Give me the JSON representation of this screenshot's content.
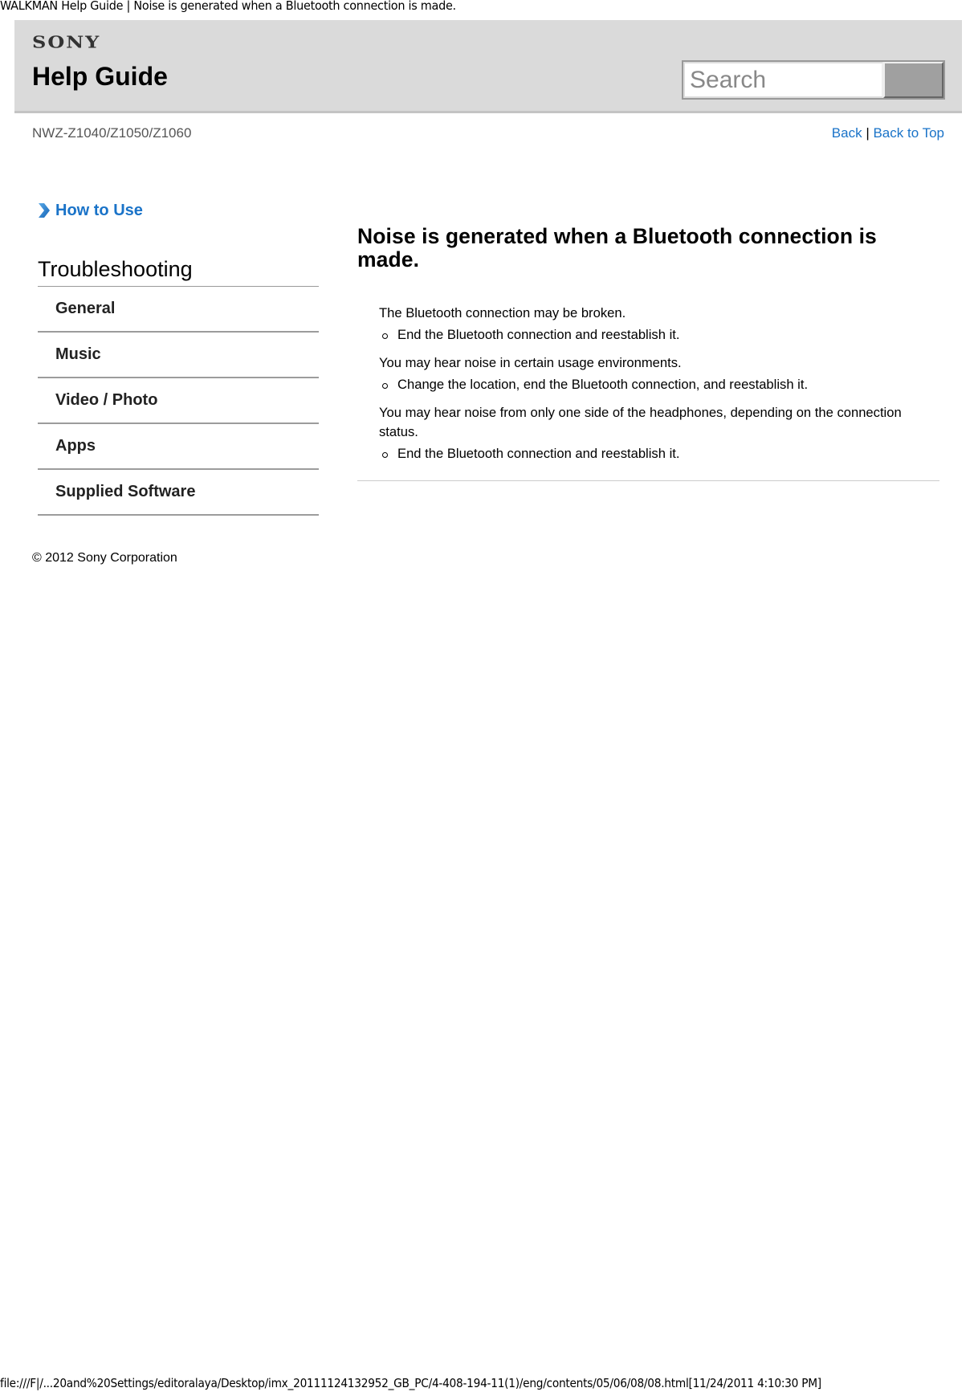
{
  "document_title": "WALKMAN Help Guide | Noise is generated when a Bluetooth connection is made.",
  "header": {
    "logo": "SONY",
    "title": "Help Guide",
    "search": {
      "placeholder": "Search",
      "value": ""
    },
    "search_button_label": ""
  },
  "model": "NWZ-Z1040/Z1050/Z1060",
  "nav": {
    "back": "Back",
    "separator": "|",
    "back_to_top": "Back to Top"
  },
  "sidebar": {
    "how_to_use": {
      "icon": "chevron-right-icon",
      "label": "How to Use"
    },
    "section_title": "Troubleshooting",
    "items": [
      {
        "label": "General"
      },
      {
        "label": "Music"
      },
      {
        "label": "Video / Photo"
      },
      {
        "label": "Apps"
      },
      {
        "label": "Supplied Software"
      }
    ]
  },
  "article": {
    "heading": "Noise is generated when a Bluetooth connection is made.",
    "sections": [
      {
        "cause": "The Bluetooth connection may be broken.",
        "remedy": "End the Bluetooth connection and reestablish it."
      },
      {
        "cause": "You may hear noise in certain usage environments.",
        "remedy": "Change the location, end the Bluetooth connection, and reestablish it."
      },
      {
        "cause": "You may hear noise from only one side of the headphones, depending on the connection status.",
        "remedy": "End the Bluetooth connection and reestablish it."
      }
    ]
  },
  "copyright": "© 2012 Sony Corporation",
  "footer_path": "file:///F|/...20and%20Settings/editoralaya/Desktop/imx_20111124132952_GB_PC/4-408-194-11(1)/eng/contents/05/06/08/08.html[11/24/2011 4:10:30 PM]",
  "colors": {
    "link": "#1a73c8",
    "header_bg": "#dadada"
  }
}
